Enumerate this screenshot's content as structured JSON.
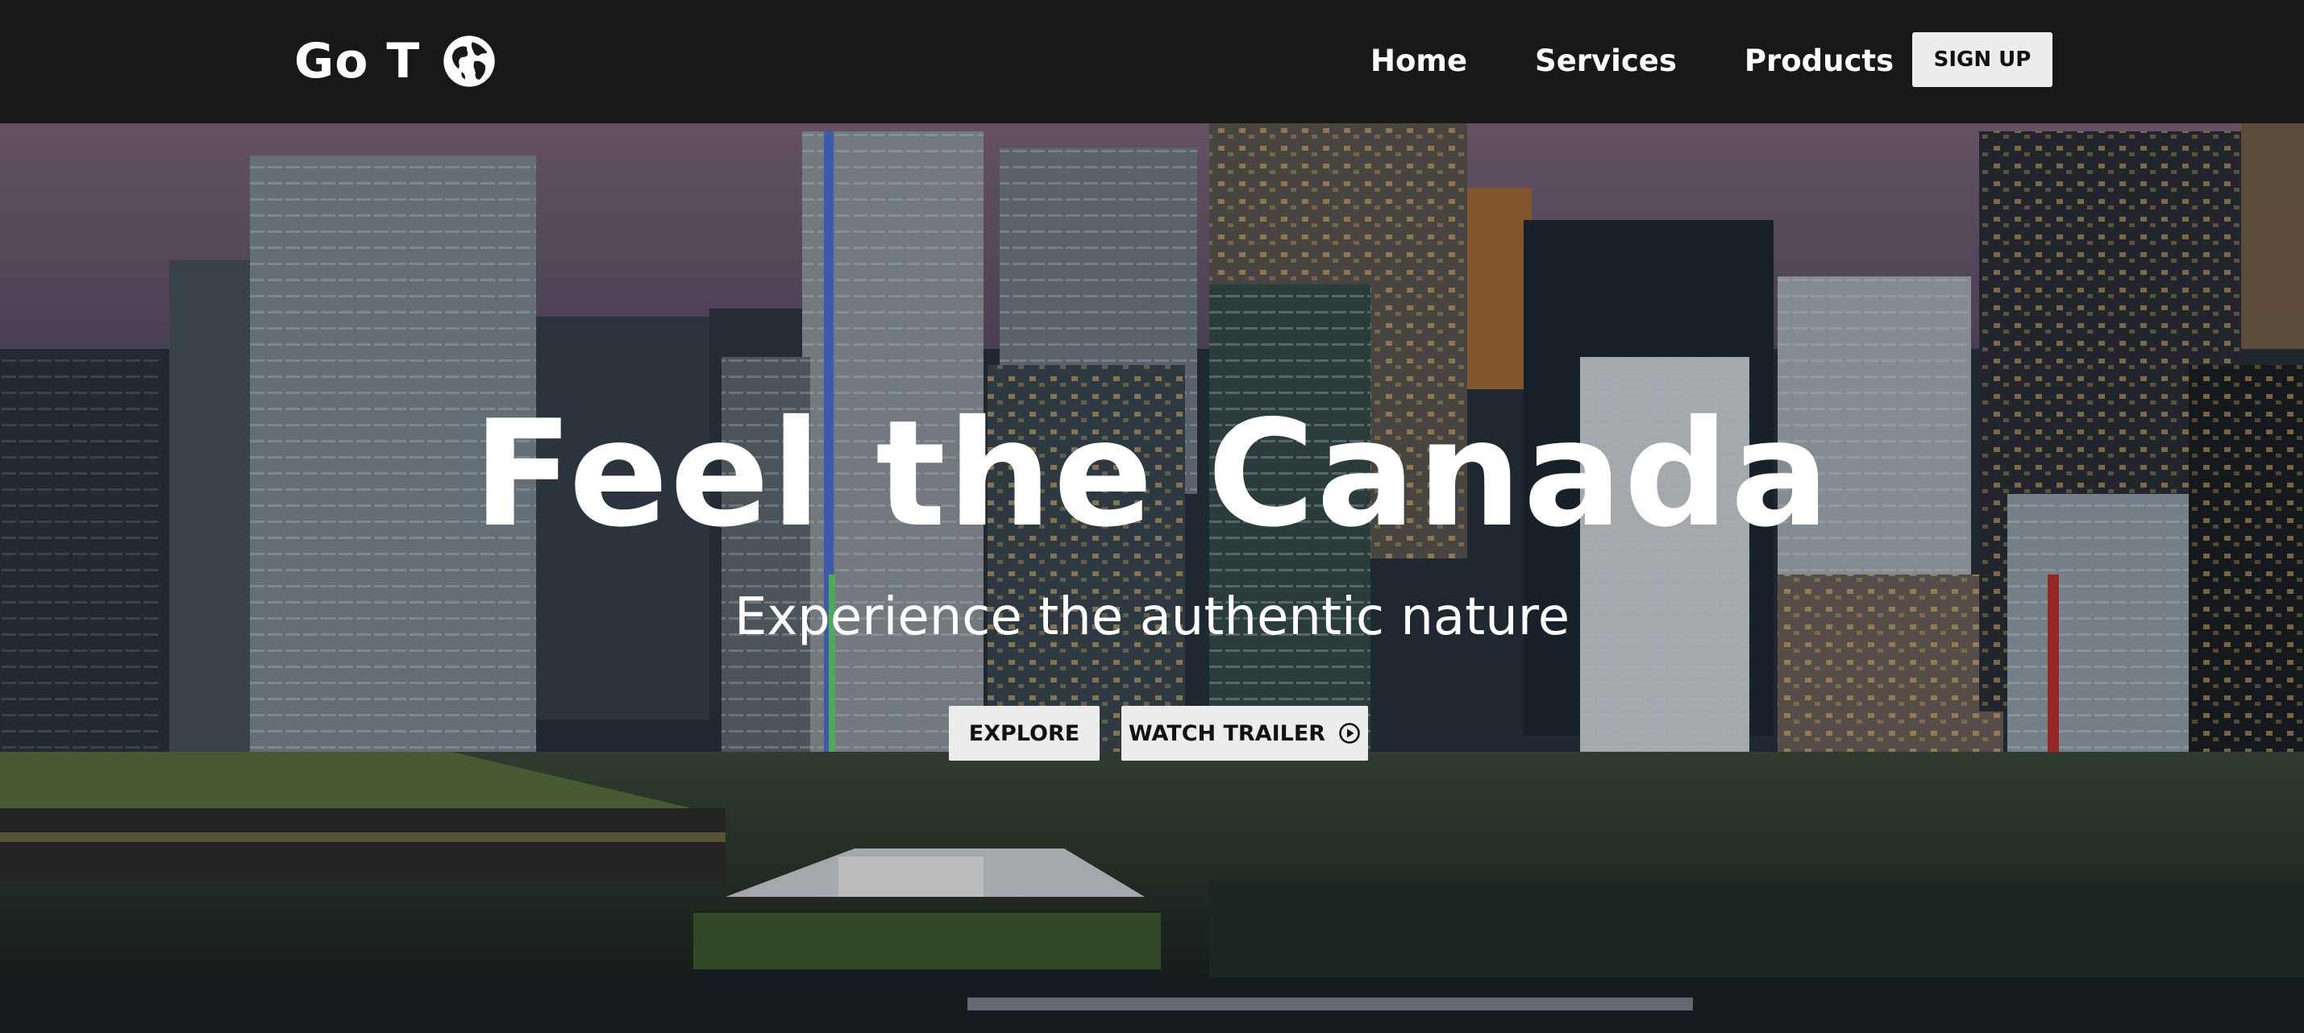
{
  "navbar": {
    "brand": "Go T",
    "brand_icon": "globe-icon",
    "links": [
      "Home",
      "Services",
      "Products"
    ],
    "signup_label": "SIGN UP"
  },
  "hero": {
    "title": "Feel the Canada",
    "subtitle": "Experience the authentic nature",
    "explore_label": "EXPLORE",
    "trailer_label": "WATCH TRAILER",
    "trailer_icon": "play-circle-icon",
    "background": "city-skyline-night-photo"
  },
  "colors": {
    "navbar_bg": "#181818",
    "button_bg": "#ececec",
    "text_light": "#ffffff",
    "text_dark": "#111111"
  }
}
